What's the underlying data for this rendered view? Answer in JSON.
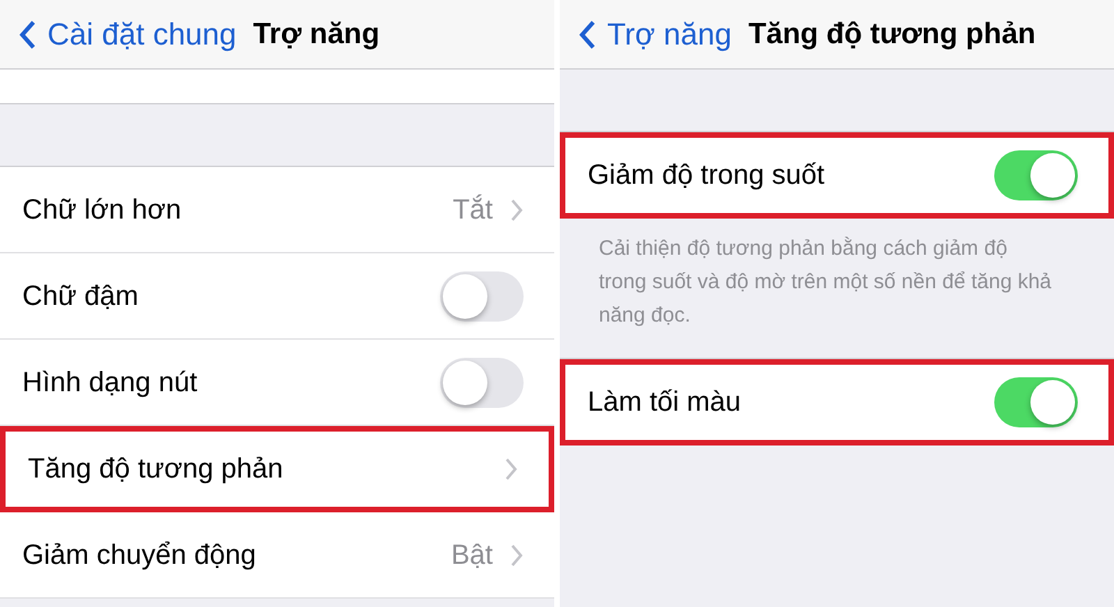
{
  "panels": [
    {
      "nav": {
        "back": "Cài đặt chung",
        "title": "Trợ năng"
      },
      "sections": [
        {
          "rows": [
            {
              "kind": "value",
              "label": "Chữ lớn hơn",
              "value": "Tắt",
              "highlighted": false
            },
            {
              "kind": "toggle",
              "label": "Chữ đậm",
              "on": false,
              "highlighted": false
            },
            {
              "kind": "toggle",
              "label": "Hình dạng nút",
              "on": false,
              "highlighted": false
            },
            {
              "kind": "link",
              "label": "Tăng độ tương phản",
              "highlighted": true
            },
            {
              "kind": "value",
              "label": "Giảm chuyển động",
              "value": "Bật",
              "highlighted": false
            }
          ]
        }
      ]
    },
    {
      "nav": {
        "back": "Trợ năng",
        "title": "Tăng độ tương phản"
      },
      "sections": [
        {
          "rows": [
            {
              "kind": "toggle",
              "label": "Giảm độ trong suốt",
              "on": true,
              "highlighted": true
            }
          ],
          "footer": "Cải thiện độ tương phản bằng cách giảm độ trong suốt và độ mờ trên một số nền để tăng khả năng đọc."
        },
        {
          "rows": [
            {
              "kind": "toggle",
              "label": "Làm tối màu",
              "on": true,
              "highlighted": true
            }
          ]
        }
      ]
    }
  ]
}
